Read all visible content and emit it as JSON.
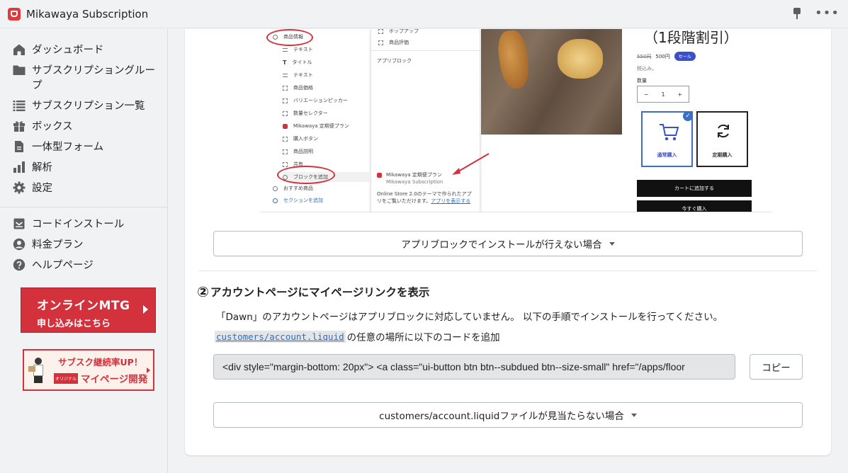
{
  "app": {
    "title": "Mikawaya Subscription"
  },
  "sidebar": {
    "items": [
      {
        "label": "ダッシュボード",
        "icon": "home-icon"
      },
      {
        "label": "サブスクリプショングループ",
        "icon": "folder-icon"
      },
      {
        "label": "サブスクリプション一覧",
        "icon": "list-icon"
      },
      {
        "label": "ボックス",
        "icon": "gift-icon"
      },
      {
        "label": "一体型フォーム",
        "icon": "document-icon"
      },
      {
        "label": "解析",
        "icon": "analytics-icon"
      },
      {
        "label": "設定",
        "icon": "gear-icon"
      }
    ],
    "secondary_items": [
      {
        "label": "コードインストール",
        "icon": "install-icon"
      },
      {
        "label": "料金プラン",
        "icon": "person-icon"
      },
      {
        "label": "ヘルプページ",
        "icon": "question-icon"
      }
    ],
    "banner_mtg": {
      "line1": "オンラインMTG",
      "line2": "申し込みはこちら"
    },
    "banner_mypage": {
      "line1": "サブスク継続率UP！",
      "tag": "オリジナル",
      "line2": "マイページ開発"
    }
  },
  "screenshot": {
    "left_items": [
      "商品情報",
      "テキスト",
      "タイトル",
      "テキスト",
      "商品価格",
      "バリエーションピッカー",
      "数量セレクター",
      "Mikawaya 定期便プラン",
      "購入ボタン",
      "商品説明",
      "共有",
      "ブロックを追加",
      "おすすめ商品",
      "セクションを追加"
    ],
    "mid_items": [
      "ポップアップ",
      "商品評価"
    ],
    "mid_heading": "アプリブロック",
    "mid_app_name": "Mikawaya 定期便プラン",
    "mid_app_sub": "Mikawaya Subscription",
    "mid_note": "Online Store 2.0のテーマで作られたアプリをご覧いただけます。",
    "mid_note_link": "アプリを表示する",
    "product_title": "（1段階割引）",
    "price_old": "550円",
    "price_new": "500円",
    "sale_badge": "セール",
    "tax_note": "税込み。",
    "qty_label": "数量",
    "qty_minus": "−",
    "qty_value": "1",
    "qty_plus": "+",
    "option_normal": "通常購入",
    "option_subscription": "定期購入",
    "add_to_cart": "カートに追加する",
    "buy_now": "今すぐ購入"
  },
  "main": {
    "disclosure1": "アプリブロックでインストールが行えない場合",
    "section2": {
      "number": "②",
      "title": "アカウントページにマイページリンクを表示",
      "description": "「Dawn」のアカウントページはアプリブロックに対応していません。 以下の手順でインストールを行ってください。",
      "file_link": "customers/account.liquid",
      "file_suffix": "の任意の場所に以下のコードを追加",
      "code": "<div style=\"margin-bottom: 20px\">  <a class=\"ui-button btn btn--subdued btn--size-small\" href=\"/apps/floor",
      "copy_label": "コピー",
      "disclosure2": "customers/account.liquidファイルが見当たらない場合"
    }
  },
  "colors": {
    "accent_red": "#d3313c",
    "link_blue": "#2c6ecb",
    "background": "#f1f2f3"
  }
}
